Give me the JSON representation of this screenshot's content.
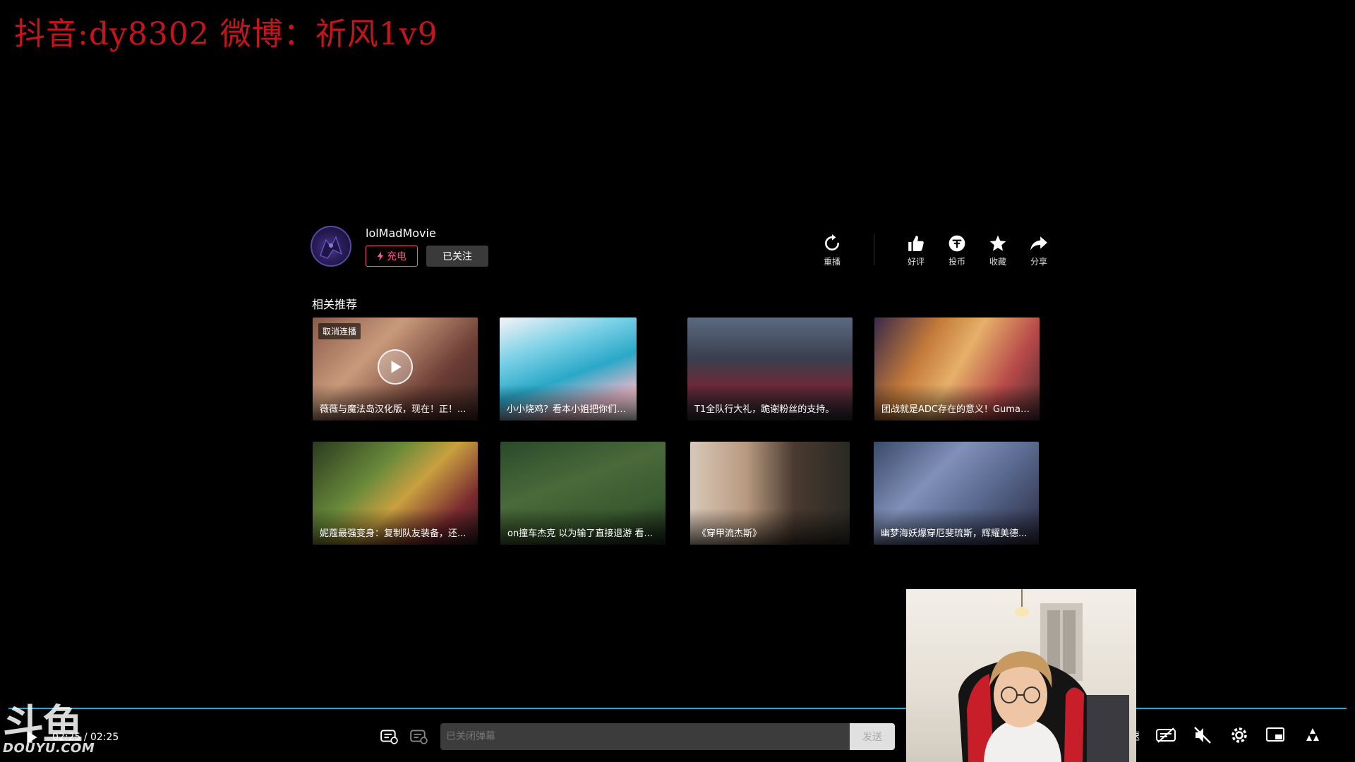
{
  "overlay": {
    "watermark": "抖音:dy8302 微博：祈风1v9"
  },
  "uploader": {
    "name": "lolMadMovie",
    "charge_label": "充电",
    "follow_label": "已关注"
  },
  "actions": {
    "replay": "重播",
    "like": "好评",
    "coin": "投币",
    "favorite": "收藏",
    "share": "分享"
  },
  "recommend": {
    "title": "相关推荐",
    "autoplay_badge": "取消连播",
    "items": [
      {
        "caption": "薇薇与魔法岛汉化版，现在！正！..."
      },
      {
        "caption": "小小烧鸡？看本小姐把你们剪得一..."
      },
      {
        "caption": "T1全队行大礼，跪谢粉丝的支持。"
      },
      {
        "caption": "团战就是ADC存在的意义！Gumay..."
      },
      {
        "caption": "妮蔻最强变身：复制队友装备，还..."
      },
      {
        "caption": "on撞车杰克 以为输了直接退游 看..."
      },
      {
        "caption": "《穿甲流杰斯》"
      },
      {
        "caption": "幽梦海妖爆穿厄斐琉斯，辉耀美德..."
      }
    ]
  },
  "player": {
    "time_current": "02:25",
    "time_sep": "/",
    "time_total": "02:25",
    "danmaku_placeholder": "已关闭弹幕",
    "send_label": "发送",
    "speed_label": "速",
    "progress": 1.0
  },
  "brand": {
    "logo_big": "斗鱼",
    "logo_small": "DOUYU.COM"
  },
  "colors": {
    "watermark": "#c4151c",
    "charge_pink": "#f25d8e",
    "progress_blue": "#2aa5e0"
  }
}
